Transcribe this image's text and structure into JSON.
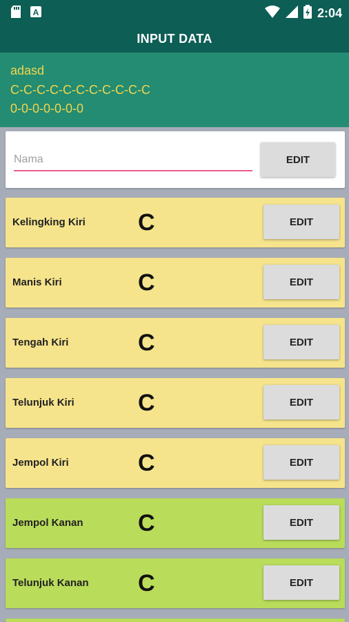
{
  "status_bar": {
    "time": "2:04",
    "left_icons": [
      "sd-card-icon",
      "font-a-icon"
    ],
    "right_icons": [
      "wifi-icon",
      "signal-icon",
      "battery-icon"
    ]
  },
  "app_bar": {
    "title": "INPUT DATA"
  },
  "summary": {
    "line1": "adasd",
    "line2": "C-C-C-C-C-C-C-C-C-C-C",
    "line3": "0-0-0-0-0-0-0"
  },
  "name_field": {
    "placeholder": "Nama",
    "value": "",
    "button_label": "EDIT"
  },
  "fingers": [
    {
      "label": "Kelingking Kiri",
      "value": "C",
      "button_label": "EDIT"
    },
    {
      "label": "Manis Kiri",
      "value": "C",
      "button_label": "EDIT"
    },
    {
      "label": "Tengah Kiri",
      "value": "C",
      "button_label": "EDIT"
    },
    {
      "label": "Telunjuk Kiri",
      "value": "C",
      "button_label": "EDIT"
    },
    {
      "label": "Jempol Kiri",
      "value": "C",
      "button_label": "EDIT"
    },
    {
      "label": "Jempol Kanan",
      "value": "C",
      "button_label": "EDIT"
    },
    {
      "label": "Telunjuk Kanan",
      "value": "C",
      "button_label": "EDIT"
    }
  ],
  "colors": {
    "primary_dark": "#0d5e55",
    "header_bg": "#238c72",
    "header_text": "#f4d54e",
    "left_hand_row": "#f6e48c",
    "right_hand_row": "#b9dc5a",
    "input_underline": "#e95a8d",
    "background": "#a7adb8"
  }
}
